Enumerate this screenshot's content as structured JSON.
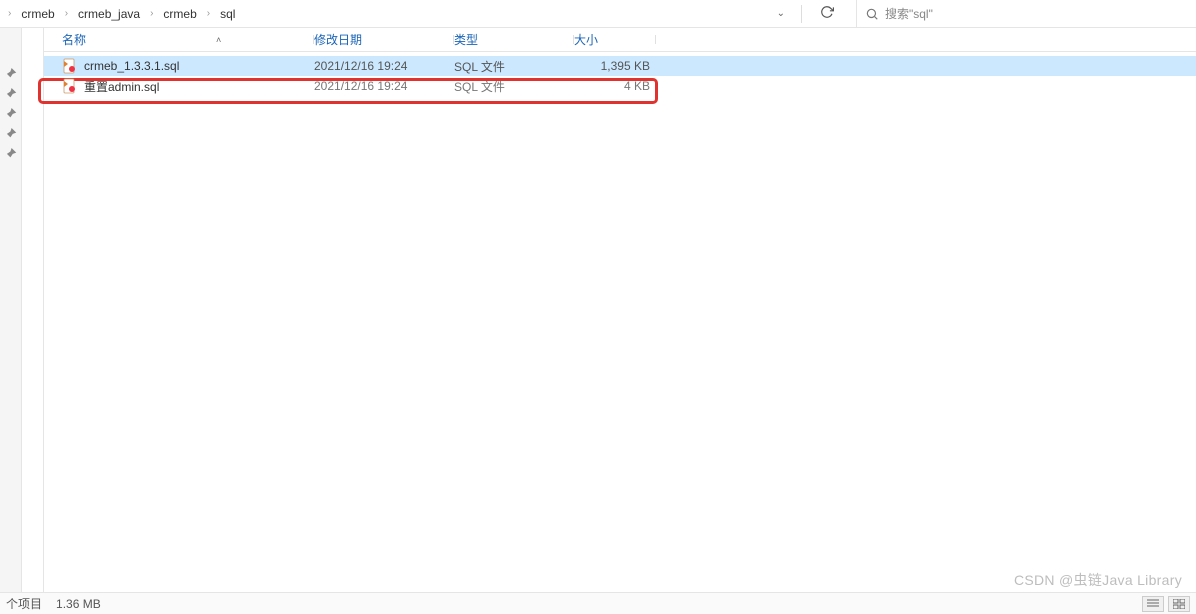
{
  "breadcrumb": {
    "items": [
      "crmeb",
      "crmeb_java",
      "crmeb",
      "sql"
    ]
  },
  "search": {
    "placeholder": "搜索\"sql\""
  },
  "columns": {
    "name": "名称",
    "date": "修改日期",
    "type": "类型",
    "size": "大小"
  },
  "files": [
    {
      "name": "crmeb_1.3.3.1.sql",
      "date": "2021/12/16 19:24",
      "type": "SQL 文件",
      "size": "1,395 KB",
      "selected": true
    },
    {
      "name": "重置admin.sql",
      "date": "2021/12/16 19:24",
      "type": "SQL 文件",
      "size": "4 KB",
      "selected": false
    }
  ],
  "status": {
    "items_label": "个项目",
    "selection_size": "1.36 MB"
  },
  "watermark": "CSDN @虫链Java Library"
}
